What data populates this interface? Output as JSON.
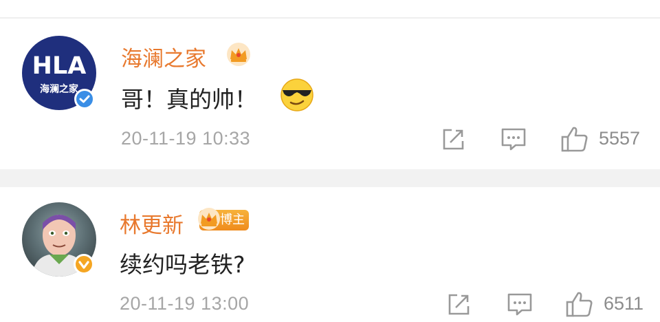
{
  "comments": [
    {
      "username": "海澜之家",
      "avatar_text": "HLA",
      "avatar_subtext": "海澜之家",
      "verified_color": "#3a8ee6",
      "user_badge": "crown-icon",
      "text": "哥！真的帅！",
      "emoji": "cool-sunglasses-emoji",
      "timestamp": "20-11-19 10:33",
      "likes": "5557"
    },
    {
      "username": "林更新",
      "avatar_text": "",
      "verified_color": "#f5a623",
      "user_badge": "crown-icon",
      "badge_label": "博主",
      "text": "续约吗老铁?",
      "timestamp": "20-11-19 13:00",
      "likes": "6511"
    }
  ],
  "actions": [
    "share-icon",
    "reply-icon",
    "like-icon"
  ],
  "colors": {
    "username": "#e8792e",
    "text": "#222222",
    "meta": "#a6a6a6",
    "separator": "#f2f2f2"
  }
}
